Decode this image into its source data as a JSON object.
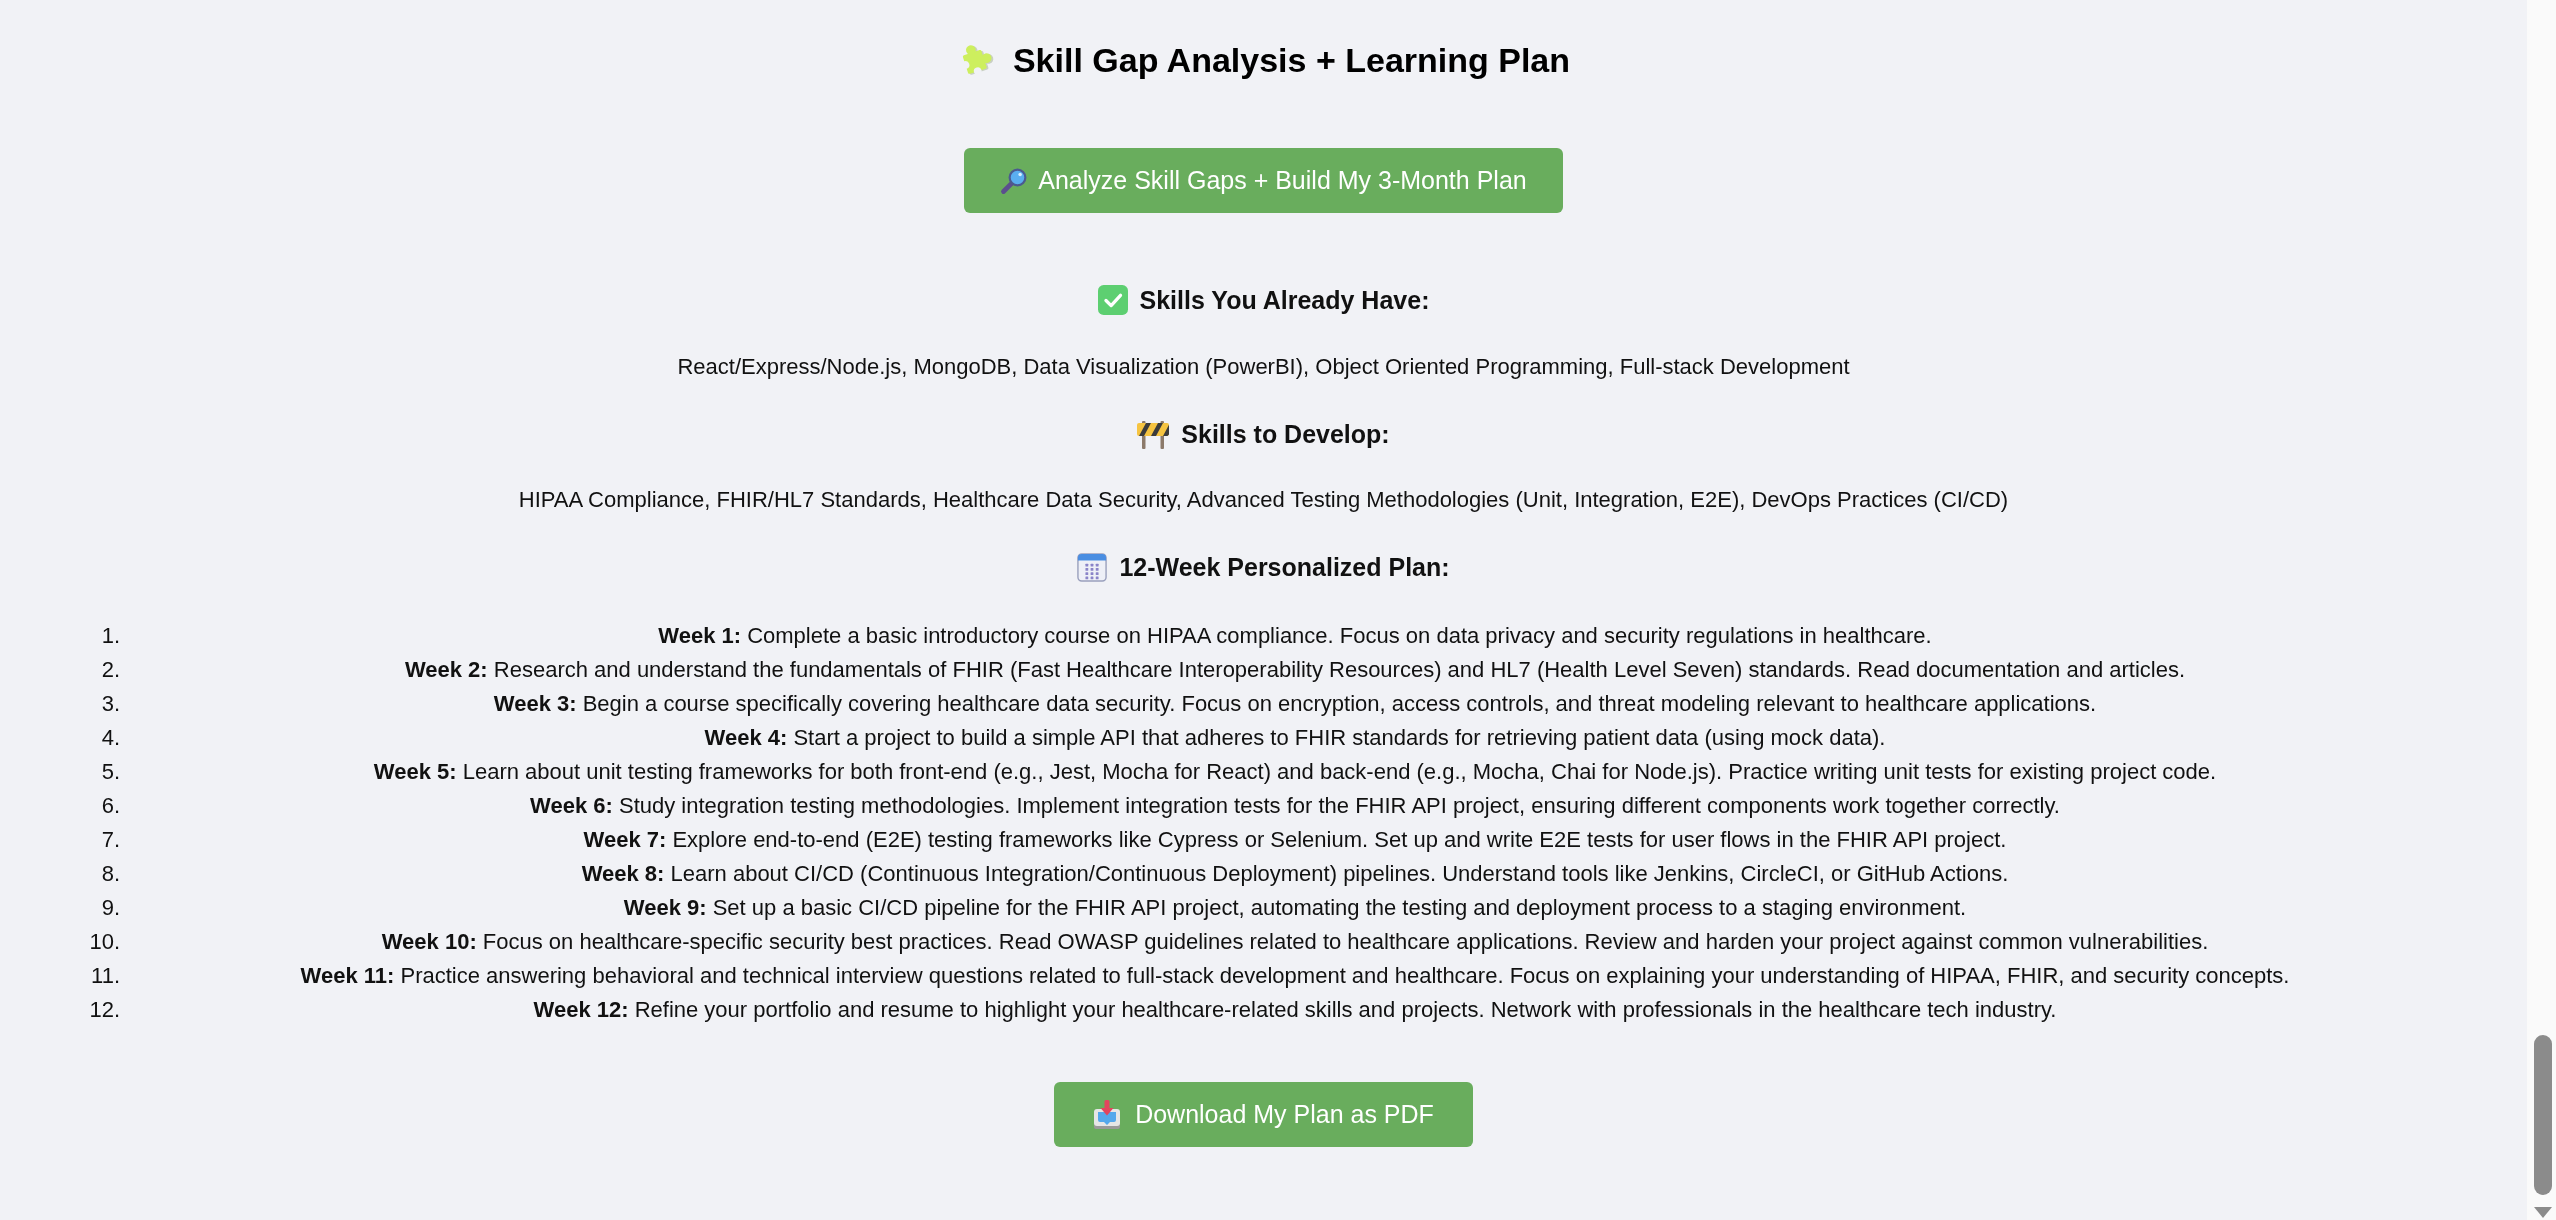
{
  "title": {
    "text": "Skill Gap Analysis + Learning Plan"
  },
  "analyze_button": {
    "label": "Analyze Skill Gaps + Build My 3-Month Plan"
  },
  "skills_you_have": {
    "heading": "Skills You Already Have:",
    "text": "React/Express/Node.js, MongoDB, Data Visualization (PowerBI), Object Oriented Programming, Full-stack Development"
  },
  "skills_to_develop": {
    "heading": "Skills to Develop:",
    "text": "HIPAA Compliance, FHIR/HL7 Standards, Healthcare Data Security, Advanced Testing Methodologies (Unit, Integration, E2E), DevOps Practices (CI/CD)"
  },
  "plan": {
    "heading": "12-Week Personalized Plan:",
    "items": [
      {
        "number": "1.",
        "text": "**Week 1:** Complete a basic introductory course on HIPAA compliance. Focus on data privacy and security regulations in healthcare."
      },
      {
        "number": "2.",
        "text": "**Week 2:** Research and understand the fundamentals of FHIR (Fast Healthcare Interoperability Resources) and HL7 (Health Level Seven) standards. Read documentation and articles."
      },
      {
        "number": "3.",
        "text": "**Week 3:** Begin a course specifically covering healthcare data security. Focus on encryption, access controls, and threat modeling relevant to healthcare applications."
      },
      {
        "number": "4.",
        "text": "**Week 4:** Start a project to build a simple API that adheres to FHIR standards for retrieving patient data (using mock data)."
      },
      {
        "number": "5.",
        "text": "**Week 5:** Learn about unit testing frameworks for both front-end (e.g., Jest, Mocha for React) and back-end (e.g., Mocha, Chai for Node.js). Practice writing unit tests for existing project code."
      },
      {
        "number": "6.",
        "text": "**Week 6:** Study integration testing methodologies. Implement integration tests for the FHIR API project, ensuring different components work together correctly."
      },
      {
        "number": "7.",
        "text": "**Week 7:** Explore end-to-end (E2E) testing frameworks like Cypress or Selenium. Set up and write E2E tests for user flows in the FHIR API project."
      },
      {
        "number": "8.",
        "text": "**Week 8:** Learn about CI/CD (Continuous Integration/Continuous Deployment) pipelines. Understand tools like Jenkins, CircleCI, or GitHub Actions."
      },
      {
        "number": "9.",
        "text": "**Week 9:** Set up a basic CI/CD pipeline for the FHIR API project, automating the testing and deployment process to a staging environment."
      },
      {
        "number": "10.",
        "text": "**Week 10:** Focus on healthcare-specific security best practices. Read OWASP guidelines related to healthcare applications. Review and harden your project against common vulnerabilities."
      },
      {
        "number": "11.",
        "text": "**Week 11:** Practice answering behavioral and technical interview questions related to full-stack development and healthcare. Focus on explaining your understanding of HIPAA, FHIR, and security concepts."
      },
      {
        "number": "12.",
        "text": "**Week 12:** Refine your portfolio and resume to highlight your healthcare-related skills and projects. Network with professionals in the healthcare tech industry."
      }
    ]
  },
  "download_button": {
    "label": "Download My Plan as PDF"
  }
}
